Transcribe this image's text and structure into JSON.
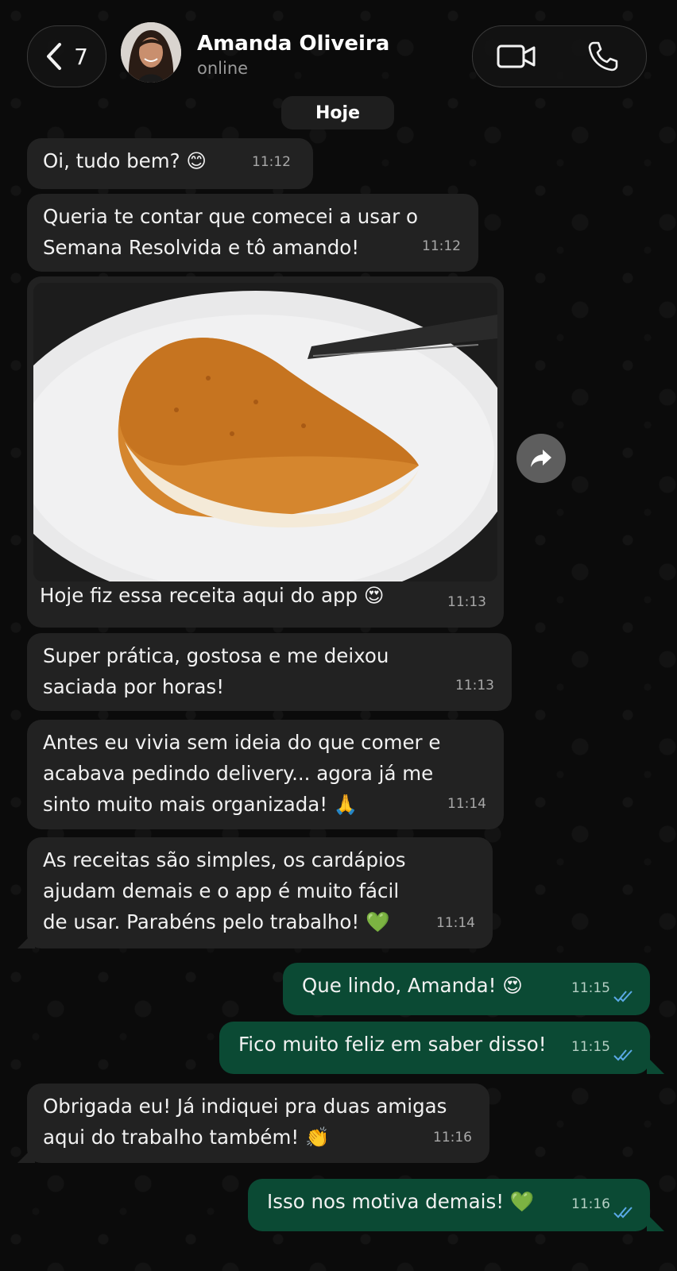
{
  "header": {
    "back_count": "7",
    "contact_name": "Amanda Oliveira",
    "contact_status": "online"
  },
  "date_chip": "Hoje",
  "messages": [
    {
      "dir": "in",
      "text": "Oi, tudo bem? 😊",
      "time": "11:12"
    },
    {
      "dir": "in",
      "lines": [
        "Queria te contar que comecei a usar o",
        "Semana Resolvida e tô amando!"
      ],
      "time": "11:12"
    },
    {
      "dir": "in",
      "type": "image",
      "caption": "Hoje fiz essa receita aqui do app 😍",
      "time": "11:13"
    },
    {
      "dir": "in",
      "lines": [
        "Super prática, gostosa e me deixou",
        "saciada por horas!"
      ],
      "time": "11:13"
    },
    {
      "dir": "in",
      "lines": [
        "Antes eu vivia sem ideia do que comer e",
        "acabava pedindo delivery... agora já me",
        "sinto muito mais organizada! 🙏"
      ],
      "time": "11:14"
    },
    {
      "dir": "in",
      "lines": [
        "As receitas são simples, os cardápios",
        "ajudam demais e o app é muito fácil",
        "de usar. Parabéns pelo trabalho! 💚"
      ],
      "time": "11:14"
    },
    {
      "dir": "out",
      "text": "Que lindo, Amanda! 😍",
      "time": "11:15"
    },
    {
      "dir": "out",
      "text": "Fico muito feliz em saber disso!",
      "time": "11:15"
    },
    {
      "dir": "in",
      "lines": [
        "Obrigada eu! Já indiquei pra duas amigas",
        "aqui do trabalho também! 👏"
      ],
      "time": "11:16"
    },
    {
      "dir": "out",
      "text": "Isso nos motiva demais! 💚",
      "time": "11:16"
    }
  ],
  "colors": {
    "incoming": "#222222",
    "outgoing": "#0b4a34",
    "background": "#0b0b0b",
    "ticks": "#5aa9e6"
  },
  "icons": [
    "chevron-left-icon",
    "video-camera-icon",
    "phone-icon",
    "forward-icon",
    "double-check-icon"
  ]
}
